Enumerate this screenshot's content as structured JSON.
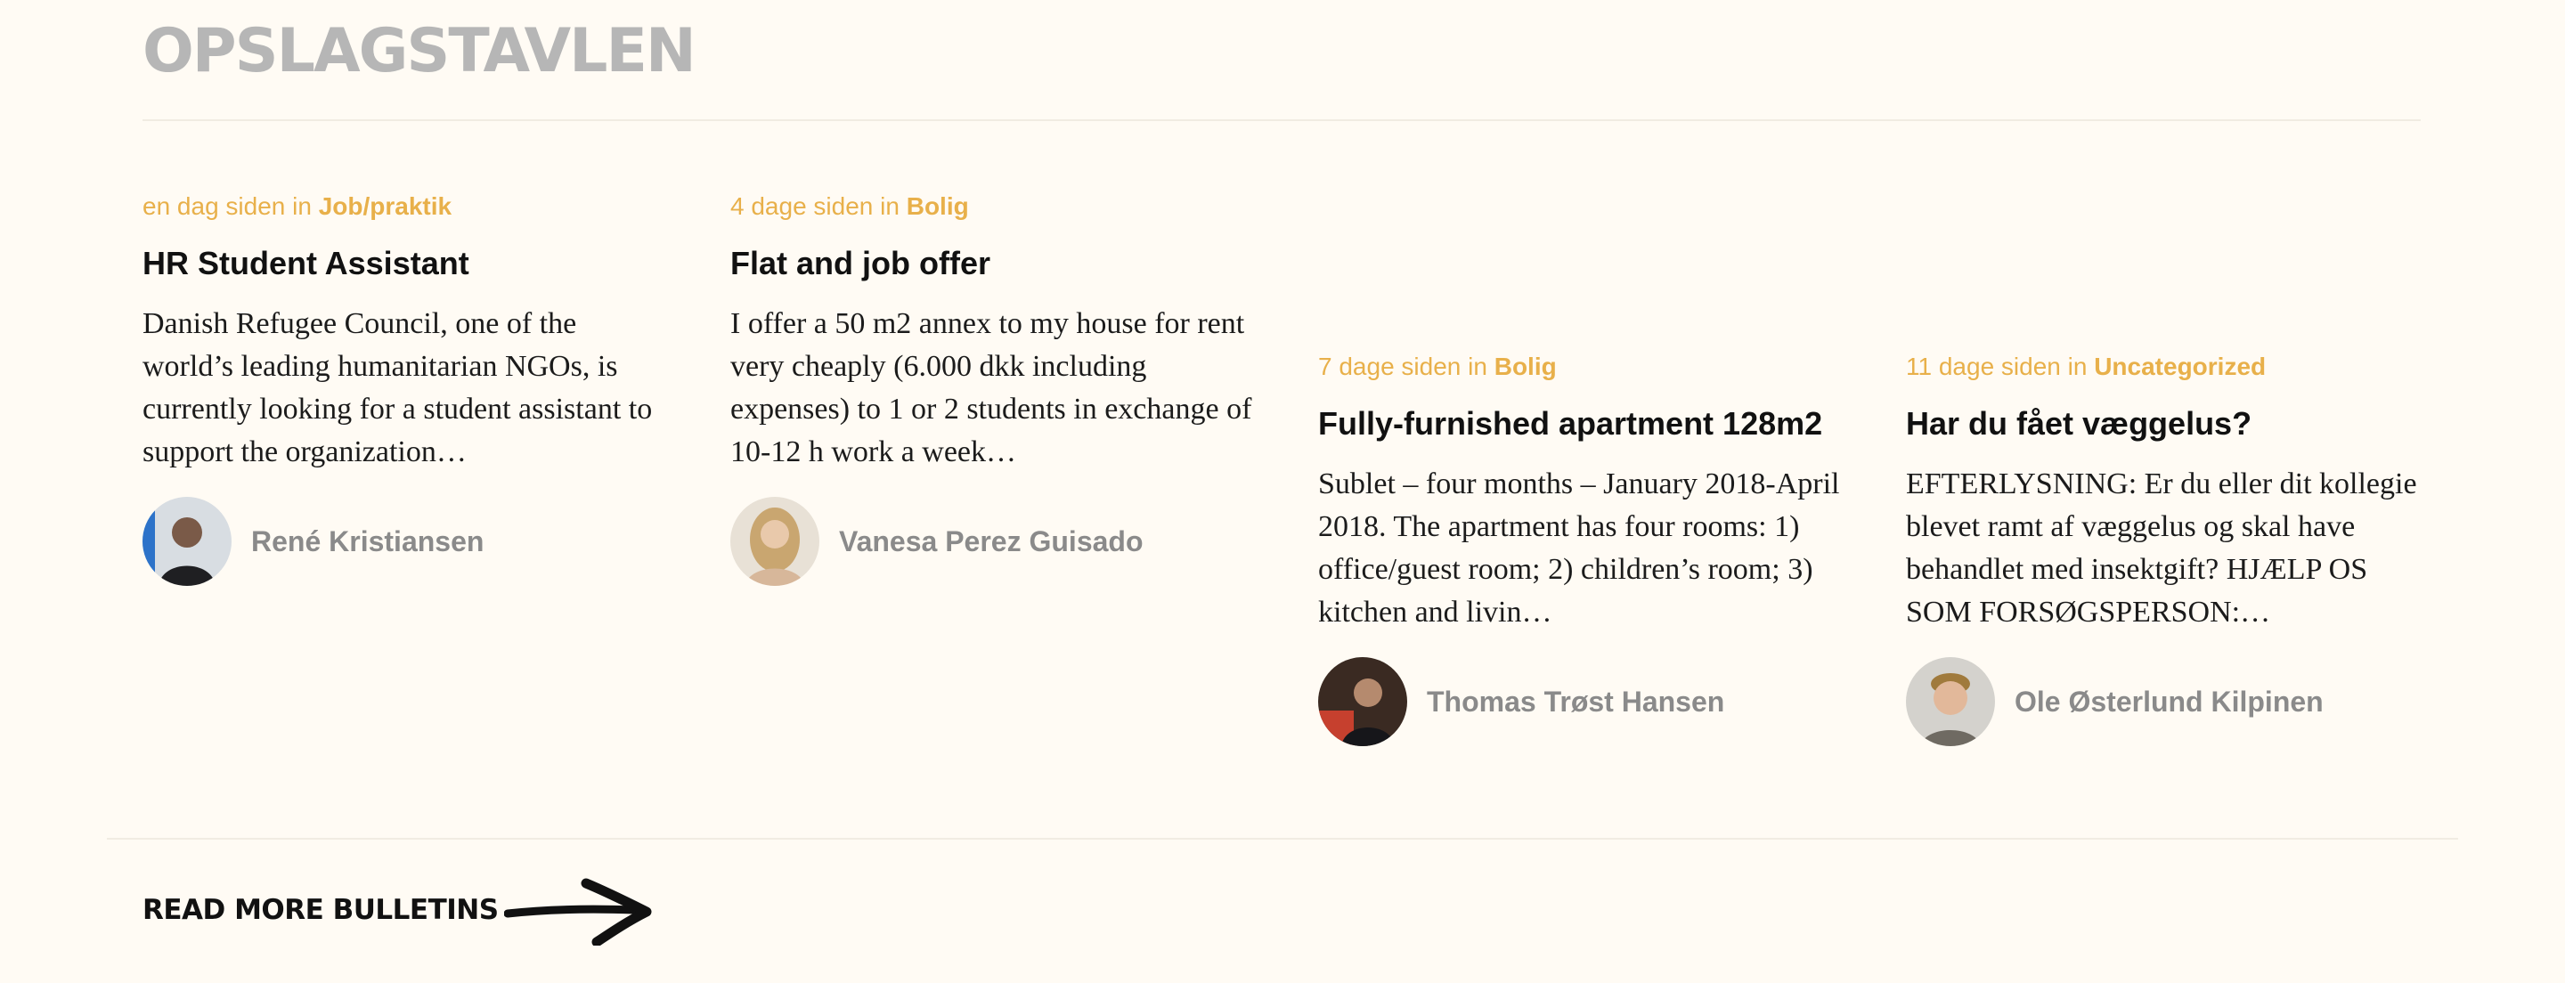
{
  "section": {
    "title": "OPSLAGSTAVLEN"
  },
  "posts": [
    {
      "time": "en dag siden in ",
      "category": "Job/praktik",
      "title": "HR Student Assistant",
      "excerpt": "Danish Refugee Council, one of the world’s leading humanitarian NGOs, is currently looking for a student assistant to support the organization…",
      "author": "René Kristiansen",
      "avatar_icon": "person-avatar-icon"
    },
    {
      "time": "4 dage siden in ",
      "category": "Bolig",
      "title": "Flat and job offer",
      "excerpt": "I offer a 50 m2 annex to my house for rent very cheaply (6.000 dkk including expenses) to 1 or 2 students in exchange of 10-12 h work a week…",
      "author": "Vanesa Perez Guisado",
      "avatar_icon": "person-avatar-icon"
    },
    {
      "time": "7 dage siden in ",
      "category": "Bolig",
      "title": "Fully-furnished apartment 128m2",
      "excerpt": "Sublet – four months – January 2018-April 2018. The apartment has four rooms: 1) office/guest room; 2) children’s room; 3) kitchen and livin…",
      "author": "Thomas Trøst Hansen",
      "avatar_icon": "person-avatar-icon"
    },
    {
      "time": "11 dage siden in ",
      "category": "Uncategorized",
      "title": "Har du fået væggelus?",
      "excerpt": "EFTERLYSNING: Er du eller dit kollegie blevet ramt af væggelus og skal have behandlet med insektgift? HJÆLP OS SOM FORSØGSPERSON:…",
      "author": "Ole Østerlund Kilpinen",
      "avatar_icon": "person-avatar-icon"
    }
  ],
  "read_more": {
    "label": "READ MORE BULLETINS",
    "icon": "arrow-right-icon"
  },
  "colors": {
    "accent": "#e8b04a",
    "background": "#fffbf4",
    "muted": "#8a8a8a"
  }
}
